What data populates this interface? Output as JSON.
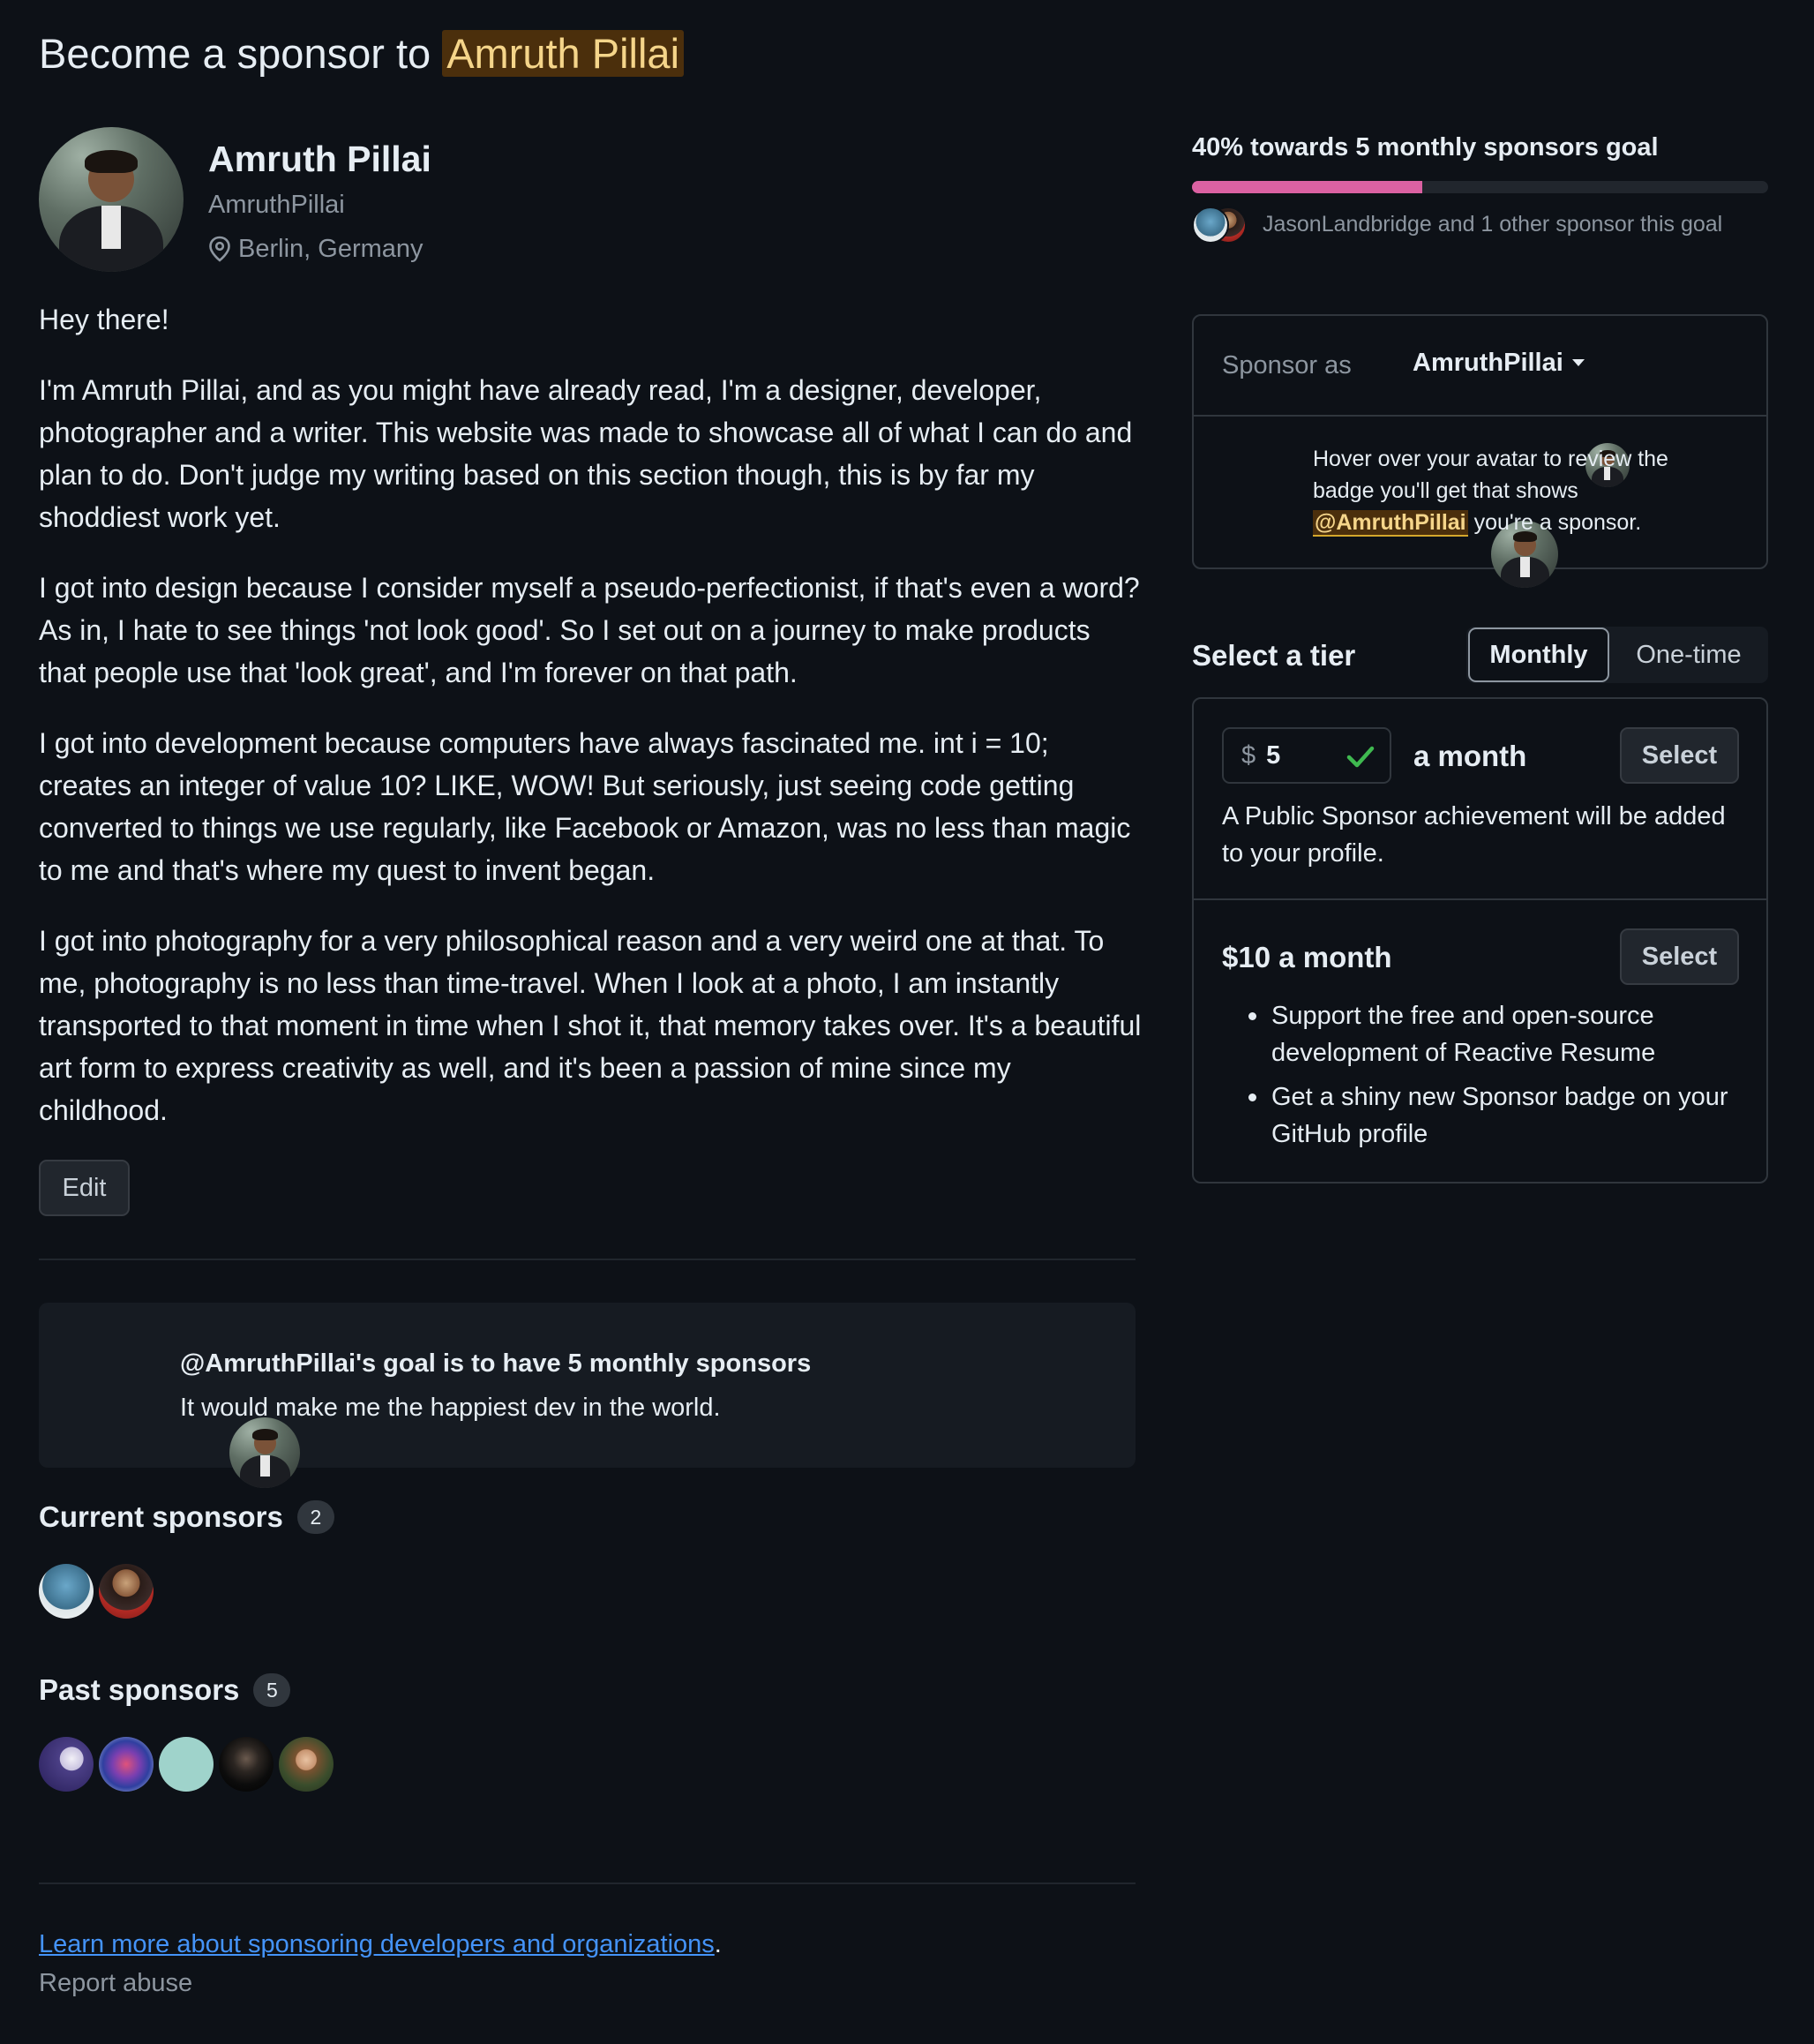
{
  "header": {
    "title_prefix": "Become a sponsor to",
    "title_name": "Amruth Pillai"
  },
  "profile": {
    "name": "Amruth Pillai",
    "handle": "AmruthPillai",
    "location": "Berlin, Germany"
  },
  "bio": {
    "greeting": "Hey there!",
    "paragraphs": [
      "I'm Amruth Pillai, and as you might have already read, I'm a designer, developer, photographer and a writer. This website was made to showcase all of what I can do and plan to do. Don't judge my writing based on this section though, this is by far my shoddiest work yet.",
      "I got into design because I consider myself a pseudo-perfectionist, if that's even a word? As in, I hate to see things 'not look good'. So I set out on a journey to make products that people use that 'look great', and I'm forever on that path.",
      "I got into development because computers have always fascinated me. int i = 10; creates an integer of value 10? LIKE, WOW! But seriously, just seeing code getting converted to things we use regularly, like Facebook or Amazon, was no less than magic to me and that's where my quest to invent began.",
      "I got into photography for a very philosophical reason and a very weird one at that. To me, photography is no less than time-travel. When I look at a photo, I am instantly transported to that moment in time when I shot it, that memory takes over. It's a beautiful art form to express creativity as well, and it's been a passion of mine since my childhood."
    ],
    "edit_label": "Edit"
  },
  "goal": {
    "title": "@AmruthPillai's goal is to have 5 monthly sponsors",
    "description": "It would make me the happiest dev in the world.",
    "progress_title": "40% towards 5 monthly sponsors goal",
    "progress_fraction": 0.4,
    "progress_sub": "JasonLandbridge and 1 other sponsor this goal"
  },
  "sponsors": {
    "current_label": "Current sponsors",
    "current_count": "2",
    "past_label": "Past sponsors",
    "past_count": "5"
  },
  "footer": {
    "learn_link": "Learn more about sponsoring developers and organizations",
    "learn_suffix": ".",
    "report": "Report abuse"
  },
  "sponsor_as": {
    "label": "Sponsor as",
    "user": "AmruthPillai",
    "hint_before": "Hover over your avatar to review the badge you'll get that shows",
    "hint_mention": "@AmruthPillai",
    "hint_after": "you're a sponsor."
  },
  "tiers": {
    "heading": "Select a tier",
    "tab_monthly": "Monthly",
    "tab_onetime": "One-time",
    "custom": {
      "currency": "$",
      "amount": "5",
      "period": "a month",
      "select_label": "Select",
      "description": "A Public Sponsor achievement will be added to your profile."
    },
    "tier2": {
      "title": "$10 a month",
      "select_label": "Select",
      "benefits": [
        "Support the free and open-source development of Reactive Resume",
        "Get a shiny new Sponsor badge on your GitHub profile"
      ]
    }
  },
  "colors": {
    "background": "#0d1117",
    "progress": "#db61a2",
    "link": "#4493f8",
    "check": "#3fb950"
  }
}
